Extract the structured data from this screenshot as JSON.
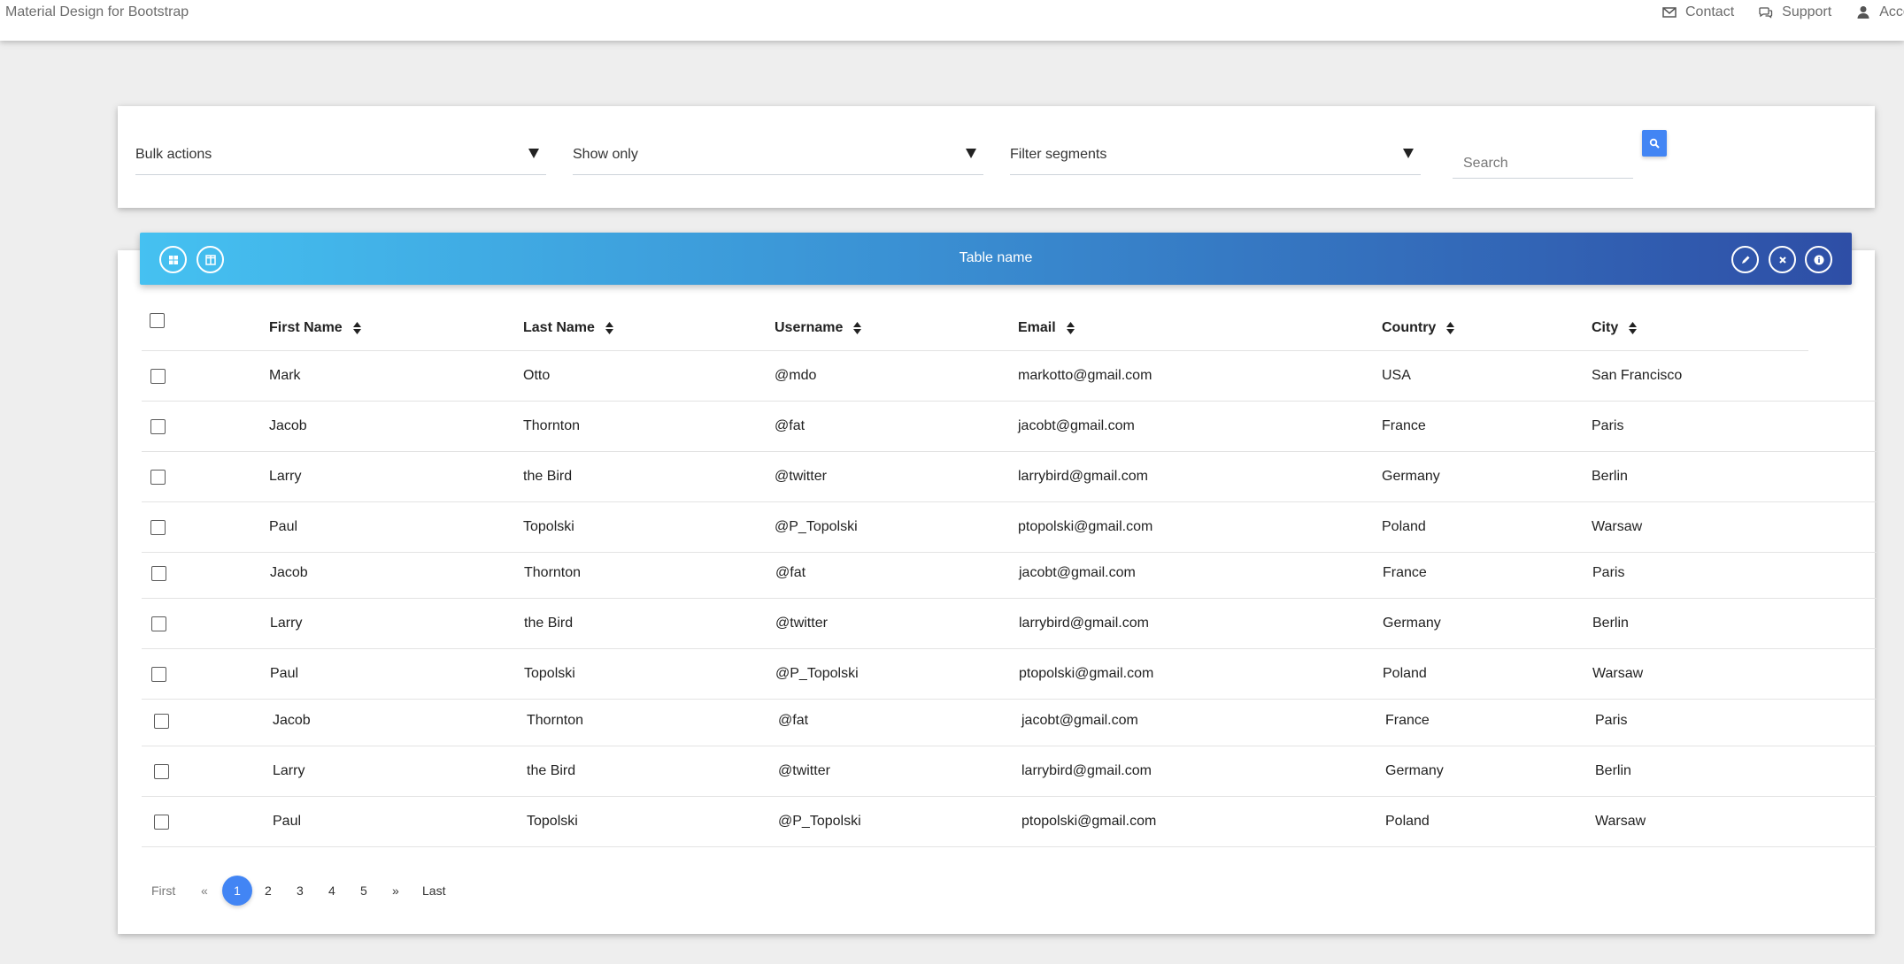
{
  "navbar": {
    "brand": "Material Design for Bootstrap",
    "links": [
      {
        "label": "Contact",
        "icon": "envelope-icon"
      },
      {
        "label": "Support",
        "icon": "comments-icon"
      },
      {
        "label": "Account",
        "icon": "user-icon"
      }
    ]
  },
  "filters": {
    "bulk_actions": "Bulk actions",
    "show_only": "Show only",
    "filter_segments": "Filter segments",
    "search_placeholder": "Search"
  },
  "table": {
    "title": "Table name",
    "columns": [
      "First Name",
      "Last Name",
      "Username",
      "Email",
      "Country",
      "City"
    ],
    "rows": [
      [
        "Mark",
        "Otto",
        "@mdo",
        "markotto@gmail.com",
        "USA",
        "San Francisco"
      ],
      [
        "Jacob",
        "Thornton",
        "@fat",
        "jacobt@gmail.com",
        "France",
        "Paris"
      ],
      [
        "Larry",
        "the Bird",
        "@twitter",
        "larrybird@gmail.com",
        "Germany",
        "Berlin"
      ],
      [
        "Paul",
        "Topolski",
        "@P_Topolski",
        "ptopolski@gmail.com",
        "Poland",
        "Warsaw"
      ],
      [
        "Jacob",
        "Thornton",
        "@fat",
        "jacobt@gmail.com",
        "France",
        "Paris"
      ],
      [
        "Larry",
        "the Bird",
        "@twitter",
        "larrybird@gmail.com",
        "Germany",
        "Berlin"
      ],
      [
        "Paul",
        "Topolski",
        "@P_Topolski",
        "ptopolski@gmail.com",
        "Poland",
        "Warsaw"
      ],
      [
        "Jacob",
        "Thornton",
        "@fat",
        "jacobt@gmail.com",
        "France",
        "Paris"
      ],
      [
        "Larry",
        "the Bird",
        "@twitter",
        "larrybird@gmail.com",
        "Germany",
        "Berlin"
      ],
      [
        "Paul",
        "Topolski",
        "@P_Topolski",
        "ptopolski@gmail.com",
        "Poland",
        "Warsaw"
      ]
    ]
  },
  "pagination": {
    "first": "First",
    "prev": "«",
    "pages": [
      "1",
      "2",
      "3",
      "4",
      "5"
    ],
    "active_page": "1",
    "next": "»",
    "last": "Last"
  },
  "colors": {
    "accent": "#4285f4",
    "header_gradient_start": "#45c1f1",
    "header_gradient_end": "#2e4ea6"
  }
}
